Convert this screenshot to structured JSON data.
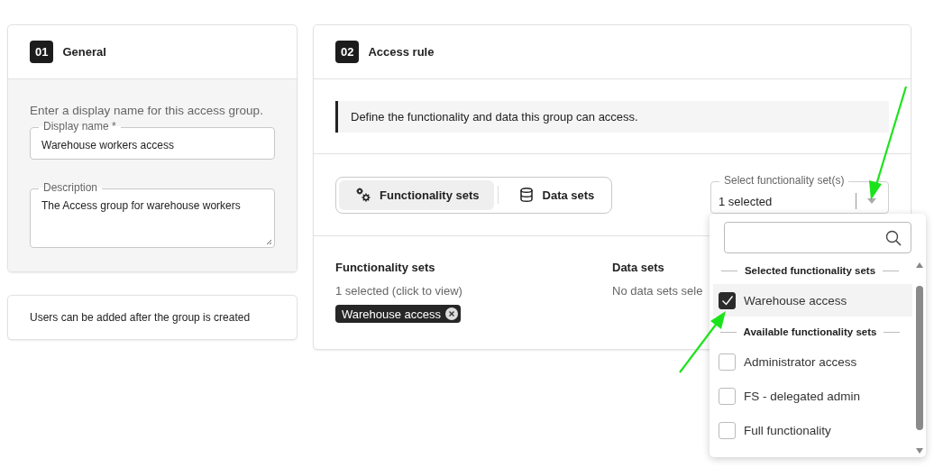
{
  "general": {
    "step": "01",
    "title": "General",
    "intro": "Enter a display name for this access group.",
    "fields": [
      {
        "kind": "input",
        "label": "Display name *",
        "value": "Warehouse workers access"
      },
      {
        "kind": "textarea",
        "label": "Description",
        "value": "The Access group for warehouse workers"
      }
    ]
  },
  "users_note": "Users can be added after the group is created",
  "access_rule": {
    "step": "02",
    "title": "Access rule",
    "note": "Define the functionality and data this group can access.",
    "tabs": [
      {
        "kind": "gears",
        "label": "Functionality sets",
        "selected": true
      },
      {
        "kind": "database",
        "label": "Data sets",
        "selected": false
      }
    ],
    "select": {
      "label": "Select functionality set(s)",
      "value": "1 selected"
    },
    "summary": [
      {
        "heading": "Functionality sets",
        "text": "1 selected (click to view)",
        "chips": [
          "Warehouse access"
        ]
      },
      {
        "heading": "Data sets",
        "text": "No data sets sele"
      }
    ]
  },
  "dropdown": {
    "groups": [
      {
        "heading": "Selected functionality sets",
        "items": [
          {
            "label": "Warehouse access",
            "checked": true,
            "highlighted": true
          }
        ]
      },
      {
        "heading": "Available functionality sets",
        "items": [
          {
            "label": "Administrator access",
            "checked": false,
            "highlighted": false
          },
          {
            "label": "FS - delegated admin",
            "checked": false,
            "highlighted": false
          },
          {
            "label": "Full functionality",
            "checked": false,
            "highlighted": false
          }
        ]
      }
    ]
  }
}
